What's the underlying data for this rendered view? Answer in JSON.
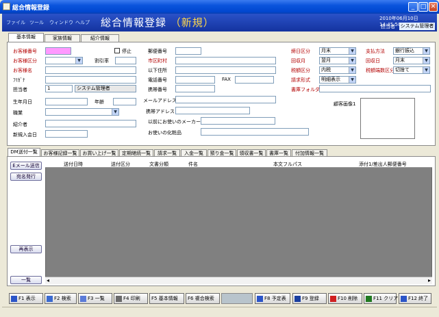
{
  "window": {
    "title": "総合情報登録"
  },
  "menu": [
    "ファイル",
    "ツール",
    "ウィンドウ",
    "ヘルプ"
  ],
  "header": {
    "title": "総合情報登録",
    "mode": "（新規）",
    "datetime": "2010年06月10日 14:45:50",
    "user_label": "担当者",
    "user": "システム管理者"
  },
  "top_tabs": [
    "基本情報",
    "家族情報",
    "紹介情報"
  ],
  "form": {
    "customer_no": "お客様番号",
    "stop": "停止",
    "customer_type": "お客様区分",
    "discount": "割引率",
    "customer_name": "お客様名",
    "kana": "ﾌﾘｶﾞﾅ",
    "staff": "担当者",
    "staff_code": "1",
    "staff_name": "システム管理者",
    "birthday": "生年月日",
    "age": "年齢",
    "occupation": "職業",
    "introducer": "紹介者",
    "join_date": "新規入会日",
    "postal": "郵便番号",
    "city": "市区町村",
    "address2": "以下住所",
    "phone": "電話番号",
    "fax": "FAX",
    "mobile": "携帯番号",
    "email": "メールアドレス",
    "mobile_email": "携帯アドレス",
    "prev_maker": "以前にお使いのメーカー",
    "cosmetics": "お使いの化粧品",
    "close_type": "締日区分",
    "close_type_val": "月末",
    "collect_month": "回収月",
    "collect_month_val": "翌月",
    "tax_type": "税額区分",
    "tax_type_val": "内税",
    "invoice_type": "請求形式",
    "invoice_type_val": "明細表示",
    "doc_folder": "書庫フォルダ",
    "pay_method": "支払方法",
    "pay_method_val": "銀行振込",
    "collect_day": "回収日",
    "collect_day_val": "月末",
    "tax_round": "税額端数区分",
    "tax_round_val": "切捨て",
    "image_label": "顧客画像1"
  },
  "lower_tabs": [
    "DM送付一覧",
    "お客様記録一覧",
    "お買い上げ一覧",
    "定期継続一覧",
    "請求一覧",
    "入金一覧",
    "預り金一覧",
    "領収書一覧",
    "書庫一覧",
    "付加情報一覧"
  ],
  "side_buttons": {
    "email": "Eメール送信",
    "label": "宛名発行",
    "redisplay": "再表示",
    "list": "一覧"
  },
  "grid_headers": [
    "送付日時",
    "送付区分",
    "文書分類",
    "件名",
    "本文フルパス",
    "添付1/差出人郵便番号"
  ],
  "fkeys": [
    "F1 表示",
    "F2 検索",
    "F3 一覧",
    "F4 印刷",
    "F5 基本情報",
    "F6 複合検索",
    "F8 予定表",
    "F9 登録",
    "F10 削除",
    "F11 クリア",
    "F12 終了"
  ]
}
